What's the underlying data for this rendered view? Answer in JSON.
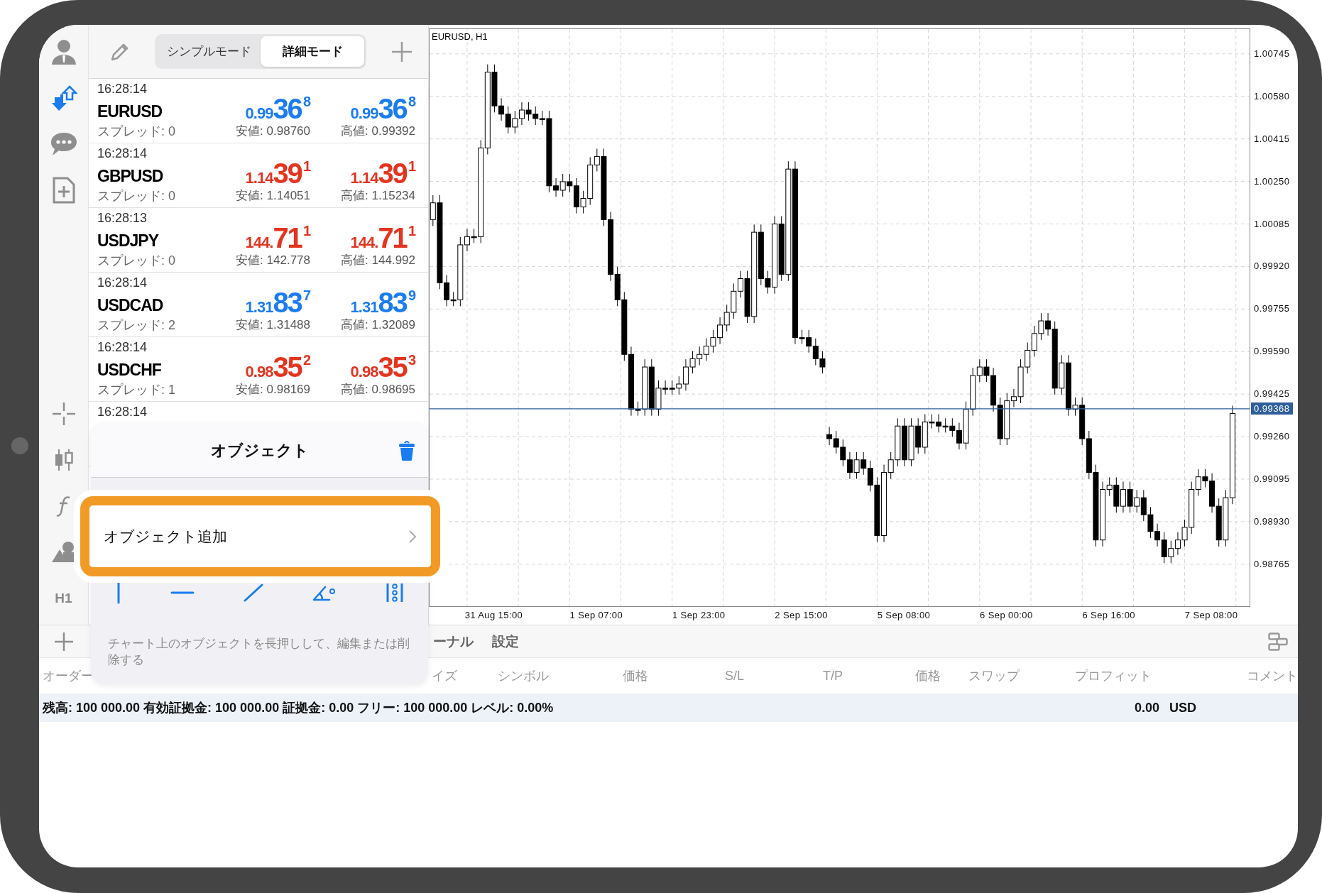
{
  "rail": {
    "timeframe": "H1"
  },
  "mode_tabs": [
    {
      "label": "シンプルモード",
      "selected": false
    },
    {
      "label": "詳細モード",
      "selected": true
    }
  ],
  "quotes": [
    {
      "time": "16:28:14",
      "symbol": "EURUSD",
      "spread": "スプレッド: 0",
      "color": "#1a7cf0",
      "bid": {
        "prefix": "0.99",
        "big": "36",
        "sup": "8"
      },
      "ask": {
        "prefix": "0.99",
        "big": "36",
        "sup": "8"
      },
      "low": "安値: 0.98760",
      "high": "高値: 0.99392"
    },
    {
      "time": "16:28:14",
      "symbol": "GBPUSD",
      "spread": "スプレッド: 0",
      "color": "#e3341f",
      "bid": {
        "prefix": "1.14",
        "big": "39",
        "sup": "1"
      },
      "ask": {
        "prefix": "1.14",
        "big": "39",
        "sup": "1"
      },
      "low": "安値: 1.14051",
      "high": "高値: 1.15234"
    },
    {
      "time": "16:28:13",
      "symbol": "USDJPY",
      "spread": "スプレッド: 0",
      "color": "#e3341f",
      "bid": {
        "prefix": "144.",
        "big": "71",
        "sup": "1"
      },
      "ask": {
        "prefix": "144.",
        "big": "71",
        "sup": "1"
      },
      "low": "安値: 142.778",
      "high": "高値: 144.992"
    },
    {
      "time": "16:28:14",
      "symbol": "USDCAD",
      "spread": "スプレッド: 2",
      "color": "#1a7cf0",
      "bid": {
        "prefix": "1.31",
        "big": "83",
        "sup": "7"
      },
      "ask": {
        "prefix": "1.31",
        "big": "83",
        "sup": "9"
      },
      "low": "安値: 1.31488",
      "high": "高値: 1.32089"
    },
    {
      "time": "16:28:14",
      "symbol": "USDCHF",
      "spread": "スプレッド: 1",
      "color": "#e3341f",
      "bid": {
        "prefix": "0.98",
        "big": "35",
        "sup": "2"
      },
      "ask": {
        "prefix": "0.98",
        "big": "35",
        "sup": "3"
      },
      "low": "安値: 0.98169",
      "high": "高値: 0.98695"
    },
    {
      "time": "16:28:14"
    }
  ],
  "chart": {
    "chart_data": {
      "type": "candlestick",
      "title": "EURUSD, H1",
      "categories": [
        null,
        null,
        null,
        null,
        null,
        null,
        null,
        null,
        null,
        "31 Aug 15:00",
        null,
        null,
        null,
        null,
        null,
        null,
        null,
        null,
        null,
        null,
        null,
        null,
        null,
        null,
        "1 Sep 07:00",
        null,
        null,
        null,
        null,
        null,
        null,
        null,
        null,
        null,
        null,
        null,
        null,
        null,
        null,
        "1 Sep 23:00",
        null,
        null,
        null,
        null,
        null,
        null,
        null,
        null,
        null,
        null,
        null,
        null,
        null,
        null,
        "2 Sep 15:00",
        null,
        null,
        null,
        null,
        null,
        null,
        null,
        null,
        null,
        null,
        null,
        null,
        null,
        null,
        "5 Sep 08:00",
        null,
        null,
        null,
        null,
        null,
        null,
        null,
        null,
        null,
        null,
        null,
        null,
        null,
        null,
        "6 Sep 00:00",
        null,
        null,
        null,
        null,
        null,
        null,
        null,
        null,
        null,
        null,
        null,
        null,
        null,
        null,
        "6 Sep 16:00",
        null,
        null,
        null,
        null,
        null,
        null,
        null,
        null,
        null,
        null,
        null,
        null,
        null,
        null,
        "7 Sep 08:00",
        null,
        null,
        null,
        null,
        null
      ],
      "ohlc": [
        [
          1.00102,
          1.00197,
          1.00077,
          1.00167
        ],
        [
          1.00167,
          1.00197,
          0.99832,
          0.99857
        ],
        [
          0.99857,
          0.99887,
          0.99766,
          0.99791
        ],
        [
          0.99791,
          0.99821,
          0.99766,
          0.99791
        ],
        [
          0.99791,
          1.00034,
          0.99766,
          1.00004
        ],
        [
          1.00004,
          1.00066,
          0.99979,
          1.00036
        ],
        [
          1.00036,
          1.00066,
          1.00011,
          1.00036
        ],
        [
          1.00036,
          1.0041,
          1.00011,
          1.0038
        ],
        [
          1.0038,
          1.00704,
          1.00355,
          1.00674
        ],
        [
          1.00674,
          1.00704,
          1.00518,
          1.00543
        ],
        [
          1.00543,
          1.00573,
          1.00486,
          1.00511
        ],
        [
          1.00511,
          1.00541,
          1.00436,
          1.00461
        ],
        [
          1.00461,
          1.00524,
          1.00436,
          1.00494
        ],
        [
          1.00494,
          1.00557,
          1.00469,
          1.00527
        ],
        [
          1.00527,
          1.00557,
          1.00486,
          1.00511
        ],
        [
          1.00511,
          1.00541,
          1.00469,
          1.00494
        ],
        [
          1.00494,
          1.00524,
          1.00469,
          1.00494
        ],
        [
          1.00494,
          1.00524,
          1.00208,
          1.00233
        ],
        [
          1.00233,
          1.00263,
          1.00191,
          1.00216
        ],
        [
          1.00216,
          1.00279,
          1.00191,
          1.00249
        ],
        [
          1.00249,
          1.00279,
          1.00208,
          1.00233
        ],
        [
          1.00233,
          1.00263,
          1.00126,
          1.00151
        ],
        [
          1.00151,
          1.00214,
          1.00126,
          1.00184
        ],
        [
          1.00184,
          1.00344,
          1.00159,
          1.00314
        ],
        [
          1.00314,
          1.00377,
          1.00289,
          1.00347
        ],
        [
          1.00347,
          1.00377,
          1.00077,
          1.00102
        ],
        [
          1.00102,
          1.00132,
          0.99864,
          0.99889
        ],
        [
          0.99889,
          0.99919,
          0.99766,
          0.99791
        ],
        [
          0.99791,
          0.99821,
          0.99554,
          0.99579
        ],
        [
          0.99579,
          0.99609,
          0.99341,
          0.99366
        ],
        [
          0.99366,
          0.99396,
          0.99341,
          0.99366
        ],
        [
          0.99366,
          0.9956,
          0.99341,
          0.9953
        ],
        [
          0.9953,
          0.9956,
          0.99341,
          0.99366
        ],
        [
          0.99366,
          0.99478,
          0.99341,
          0.99448
        ],
        [
          0.99448,
          0.99478,
          0.99423,
          0.99448
        ],
        [
          0.99448,
          0.99478,
          0.99423,
          0.99448
        ],
        [
          0.99448,
          0.99494,
          0.99423,
          0.99464
        ],
        [
          0.99464,
          0.9956,
          0.99439,
          0.9953
        ],
        [
          0.9953,
          0.99592,
          0.99505,
          0.99562
        ],
        [
          0.99562,
          0.99609,
          0.99537,
          0.99579
        ],
        [
          0.99579,
          0.99641,
          0.99554,
          0.99611
        ],
        [
          0.99611,
          0.99674,
          0.99586,
          0.99644
        ],
        [
          0.99644,
          0.99723,
          0.99619,
          0.99693
        ],
        [
          0.99693,
          0.99772,
          0.99668,
          0.99742
        ],
        [
          0.99742,
          0.99854,
          0.99717,
          0.99824
        ],
        [
          0.99824,
          0.99903,
          0.99799,
          0.99873
        ],
        [
          0.99873,
          0.99903,
          0.99701,
          0.99726
        ],
        [
          0.99726,
          1.00083,
          0.99701,
          1.00053
        ],
        [
          1.00053,
          1.00083,
          0.99848,
          0.99873
        ],
        [
          0.99873,
          0.99903,
          0.99815,
          0.9984
        ],
        [
          0.9984,
          1.00115,
          0.99815,
          1.00085
        ],
        [
          1.00085,
          1.00115,
          0.99864,
          0.99889
        ],
        [
          0.99889,
          1.00328,
          0.99864,
          1.00298
        ],
        [
          1.00298,
          1.00328,
          0.99619,
          0.99644
        ],
        [
          0.99644,
          0.99674,
          0.99619,
          0.99644
        ],
        [
          0.99644,
          0.99674,
          0.99586,
          0.99611
        ],
        [
          0.99611,
          0.99641,
          0.99537,
          0.99562
        ],
        [
          0.99562,
          0.99592,
          0.99505,
          0.9953
        ],
        [
          0.99268,
          0.99298,
          0.99227,
          0.99252
        ],
        [
          0.99252,
          0.99282,
          0.99194,
          0.99219
        ],
        [
          0.99219,
          0.99249,
          0.99145,
          0.9917
        ],
        [
          0.9917,
          0.992,
          0.99096,
          0.99121
        ],
        [
          0.99121,
          0.992,
          0.99096,
          0.9917
        ],
        [
          0.9917,
          0.992,
          0.99112,
          0.99137
        ],
        [
          0.99137,
          0.99167,
          0.99047,
          0.99072
        ],
        [
          0.99072,
          0.99102,
          0.98851,
          0.98876
        ],
        [
          0.98876,
          0.99151,
          0.98851,
          0.99121
        ],
        [
          0.99121,
          0.992,
          0.99096,
          0.9917
        ],
        [
          0.9917,
          0.99331,
          0.99145,
          0.99301
        ],
        [
          0.99301,
          0.99331,
          0.99145,
          0.9917
        ],
        [
          0.9917,
          0.99331,
          0.99145,
          0.99301
        ],
        [
          0.99301,
          0.99331,
          0.99194,
          0.99219
        ],
        [
          0.99219,
          0.99347,
          0.99194,
          0.99317
        ],
        [
          0.99317,
          0.99347,
          0.99292,
          0.99317
        ],
        [
          0.99317,
          0.99347,
          0.99276,
          0.99301
        ],
        [
          0.99301,
          0.99331,
          0.99276,
          0.99301
        ],
        [
          0.99301,
          0.99331,
          0.99259,
          0.99284
        ],
        [
          0.99284,
          0.99314,
          0.9921,
          0.99235
        ],
        [
          0.99235,
          0.99396,
          0.9921,
          0.99366
        ],
        [
          0.99366,
          0.99527,
          0.99341,
          0.99497
        ],
        [
          0.99497,
          0.9956,
          0.99472,
          0.9953
        ],
        [
          0.9953,
          0.9956,
          0.99472,
          0.99497
        ],
        [
          0.99497,
          0.99527,
          0.99357,
          0.99382
        ],
        [
          0.99382,
          0.99412,
          0.99227,
          0.99252
        ],
        [
          0.99252,
          0.99429,
          0.99227,
          0.99399
        ],
        [
          0.99399,
          0.99445,
          0.99374,
          0.99415
        ],
        [
          0.99415,
          0.9956,
          0.9939,
          0.9953
        ],
        [
          0.9953,
          0.99625,
          0.99505,
          0.99595
        ],
        [
          0.99595,
          0.9969,
          0.9957,
          0.9966
        ],
        [
          0.9966,
          0.99739,
          0.99635,
          0.99709
        ],
        [
          0.99709,
          0.99739,
          0.99652,
          0.99677
        ],
        [
          0.99677,
          0.99707,
          0.99423,
          0.99448
        ],
        [
          0.99448,
          0.99576,
          0.99423,
          0.99546
        ],
        [
          0.99546,
          0.99576,
          0.99341,
          0.99366
        ],
        [
          0.99366,
          0.99412,
          0.99341,
          0.99382
        ],
        [
          0.99382,
          0.99412,
          0.99227,
          0.99252
        ],
        [
          0.99252,
          0.99282,
          0.99096,
          0.99121
        ],
        [
          0.99121,
          0.99151,
          0.98834,
          0.98859
        ],
        [
          0.98859,
          0.99085,
          0.98834,
          0.99055
        ],
        [
          0.99055,
          0.99102,
          0.9903,
          0.99072
        ],
        [
          0.99072,
          0.99102,
          0.98965,
          0.9899
        ],
        [
          0.9899,
          0.99085,
          0.98965,
          0.99055
        ],
        [
          0.99055,
          0.99085,
          0.98965,
          0.9899
        ],
        [
          0.9899,
          0.99053,
          0.98965,
          0.99023
        ],
        [
          0.99023,
          0.99053,
          0.98932,
          0.98957
        ],
        [
          0.98957,
          0.98987,
          0.98867,
          0.98892
        ],
        [
          0.98892,
          0.98922,
          0.98834,
          0.98859
        ],
        [
          0.98859,
          0.98889,
          0.98769,
          0.98794
        ],
        [
          0.98794,
          0.98856,
          0.98769,
          0.98826
        ],
        [
          0.98826,
          0.98889,
          0.98801,
          0.98859
        ],
        [
          0.98859,
          0.98938,
          0.98834,
          0.98908
        ],
        [
          0.98908,
          0.99085,
          0.98883,
          0.99055
        ],
        [
          0.99055,
          0.99134,
          0.9903,
          0.99104
        ],
        [
          0.99104,
          0.99134,
          0.99063,
          0.99088
        ],
        [
          0.99088,
          0.99118,
          0.98965,
          0.9899
        ],
        [
          0.9899,
          0.9902,
          0.98834,
          0.98859
        ],
        [
          0.98859,
          0.99053,
          0.98834,
          0.99023
        ],
        [
          0.99023,
          0.9938,
          0.98998,
          0.9935
        ],
        null,
        null
      ],
      "grid": true,
      "ylim": [
        0.98602,
        1.00841
      ],
      "yticks": [
        {
          "value": 1.00745,
          "label": "1.00745"
        },
        {
          "value": 1.0058,
          "label": "1.00580"
        },
        {
          "value": 1.00415,
          "label": "1.00415"
        },
        {
          "value": 1.0025,
          "label": "1.00250"
        },
        {
          "value": 1.00085,
          "label": "1.00085"
        },
        {
          "value": 0.9992,
          "label": "0.99920"
        },
        {
          "value": 0.99755,
          "label": "0.99755"
        },
        {
          "value": 0.9959,
          "label": "0.99590"
        },
        {
          "value": 0.99425,
          "label": "0.99425"
        },
        {
          "value": 0.9926,
          "label": "0.99260"
        },
        {
          "value": 0.99095,
          "label": "0.99095"
        },
        {
          "value": 0.9893,
          "label": "0.98930"
        },
        {
          "value": 0.98765,
          "label": "0.98765"
        }
      ],
      "ref_lines": [
        {
          "axis": "y",
          "value": 0.99368,
          "label": "0.99368",
          "color": "#2f5f9a"
        }
      ]
    }
  },
  "popup": {
    "title": "オブジェクト",
    "items": [
      {
        "label": "オブジェクト追加",
        "highlighted": true
      }
    ],
    "hint": "チャート上のオブジェクトを長押しして、編集または削除する"
  },
  "bottom_tabs": [
    {
      "label": "ーナル",
      "selected": false
    },
    {
      "label": "設定",
      "selected": false
    }
  ],
  "columns": [
    "オーダー",
    "イズ",
    "シンボル",
    "価格",
    "S/L",
    "T/P",
    "価格",
    "スワップ",
    "プロフィット",
    "コメント"
  ],
  "status_bar": {
    "summary": "残高: 100 000.00 有効証拠金: 100 000.00 証拠金: 0.00 フリー: 100 000.00 レベル: 0.00%",
    "profit": "0.00",
    "currency": "USD"
  }
}
